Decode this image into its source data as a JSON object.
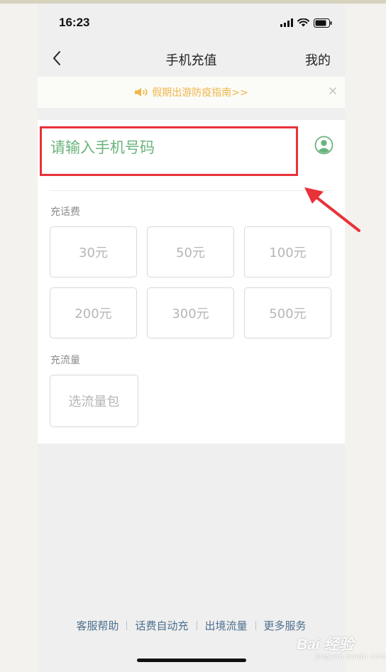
{
  "status_bar": {
    "time": "16:23"
  },
  "nav": {
    "title": "手机充值",
    "right_label": "我的"
  },
  "notice": {
    "text": "假期出游防疫指南>>"
  },
  "phone_input": {
    "placeholder": "请输入手机号码",
    "value": ""
  },
  "recharge": {
    "label": "充话费",
    "options": [
      "30元",
      "50元",
      "100元",
      "200元",
      "300元",
      "500元"
    ]
  },
  "data_plan": {
    "label": "充流量",
    "option": "选流量包"
  },
  "footer": {
    "links": [
      "客服帮助",
      "话费自动充",
      "出境流量",
      "更多服务"
    ]
  },
  "watermark": {
    "brand": "Bai 经验",
    "url": "jingyan.baidu.com"
  },
  "colors": {
    "accent_green": "#6ab47c",
    "notice_orange": "#f0b548",
    "highlight_red": "#e8323a",
    "footer_link": "#4d6f8f"
  }
}
